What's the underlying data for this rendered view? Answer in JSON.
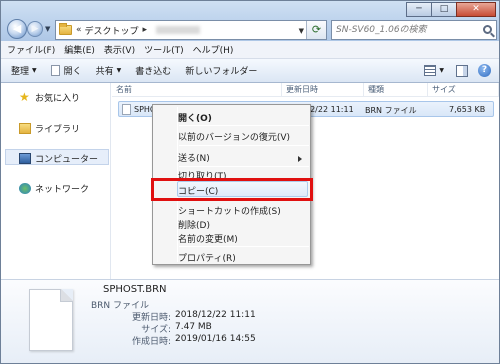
{
  "address": {
    "separator": "«",
    "crumb": "デスクトップ",
    "crumb_sep": "▸"
  },
  "search": {
    "placeholder": "SN-SV60_1.06の検索"
  },
  "window_controls": {
    "minimize": "─",
    "maximize": "□",
    "close": "✕"
  },
  "menubar": [
    "ファイル(F)",
    "編集(E)",
    "表示(V)",
    "ツール(T)",
    "ヘルプ(H)"
  ],
  "toolbar": {
    "organize": "整理",
    "open": "開く",
    "share": "共有",
    "burn": "書き込む",
    "new_folder": "新しいフォルダー"
  },
  "navpane": [
    "お気に入り",
    "ライブラリ",
    "コンピューター",
    "ネットワーク"
  ],
  "columns": {
    "name": "名前",
    "modified": "更新日時",
    "type": "種類",
    "size": "サイズ"
  },
  "file_row": {
    "name": "SPHOS",
    "modified": "12/22 11:11",
    "type": "BRN ファイル",
    "size": "7,653 KB"
  },
  "context_menu": {
    "open": "開く(O)",
    "restore": "以前のバージョンの復元(V)",
    "send_to": "送る(N)",
    "cut": "切り取り(T)",
    "copy": "コピー(C)",
    "shortcut": "ショートカットの作成(S)",
    "delete": "削除(D)",
    "rename": "名前の変更(M)",
    "properties": "プロパティ(R)"
  },
  "details": {
    "filename": "SPHOST.BRN",
    "filetype": "BRN ファイル",
    "modified_label": "更新日時:",
    "modified_value": "2018/12/22 11:11",
    "size_label": "サイズ:",
    "size_value": "7.47 MB",
    "created_label": "作成日時:",
    "created_value": "2019/01/16 14:55"
  },
  "colors": {
    "highlight_box": "#e01010",
    "selection": "#d9e7f8"
  }
}
